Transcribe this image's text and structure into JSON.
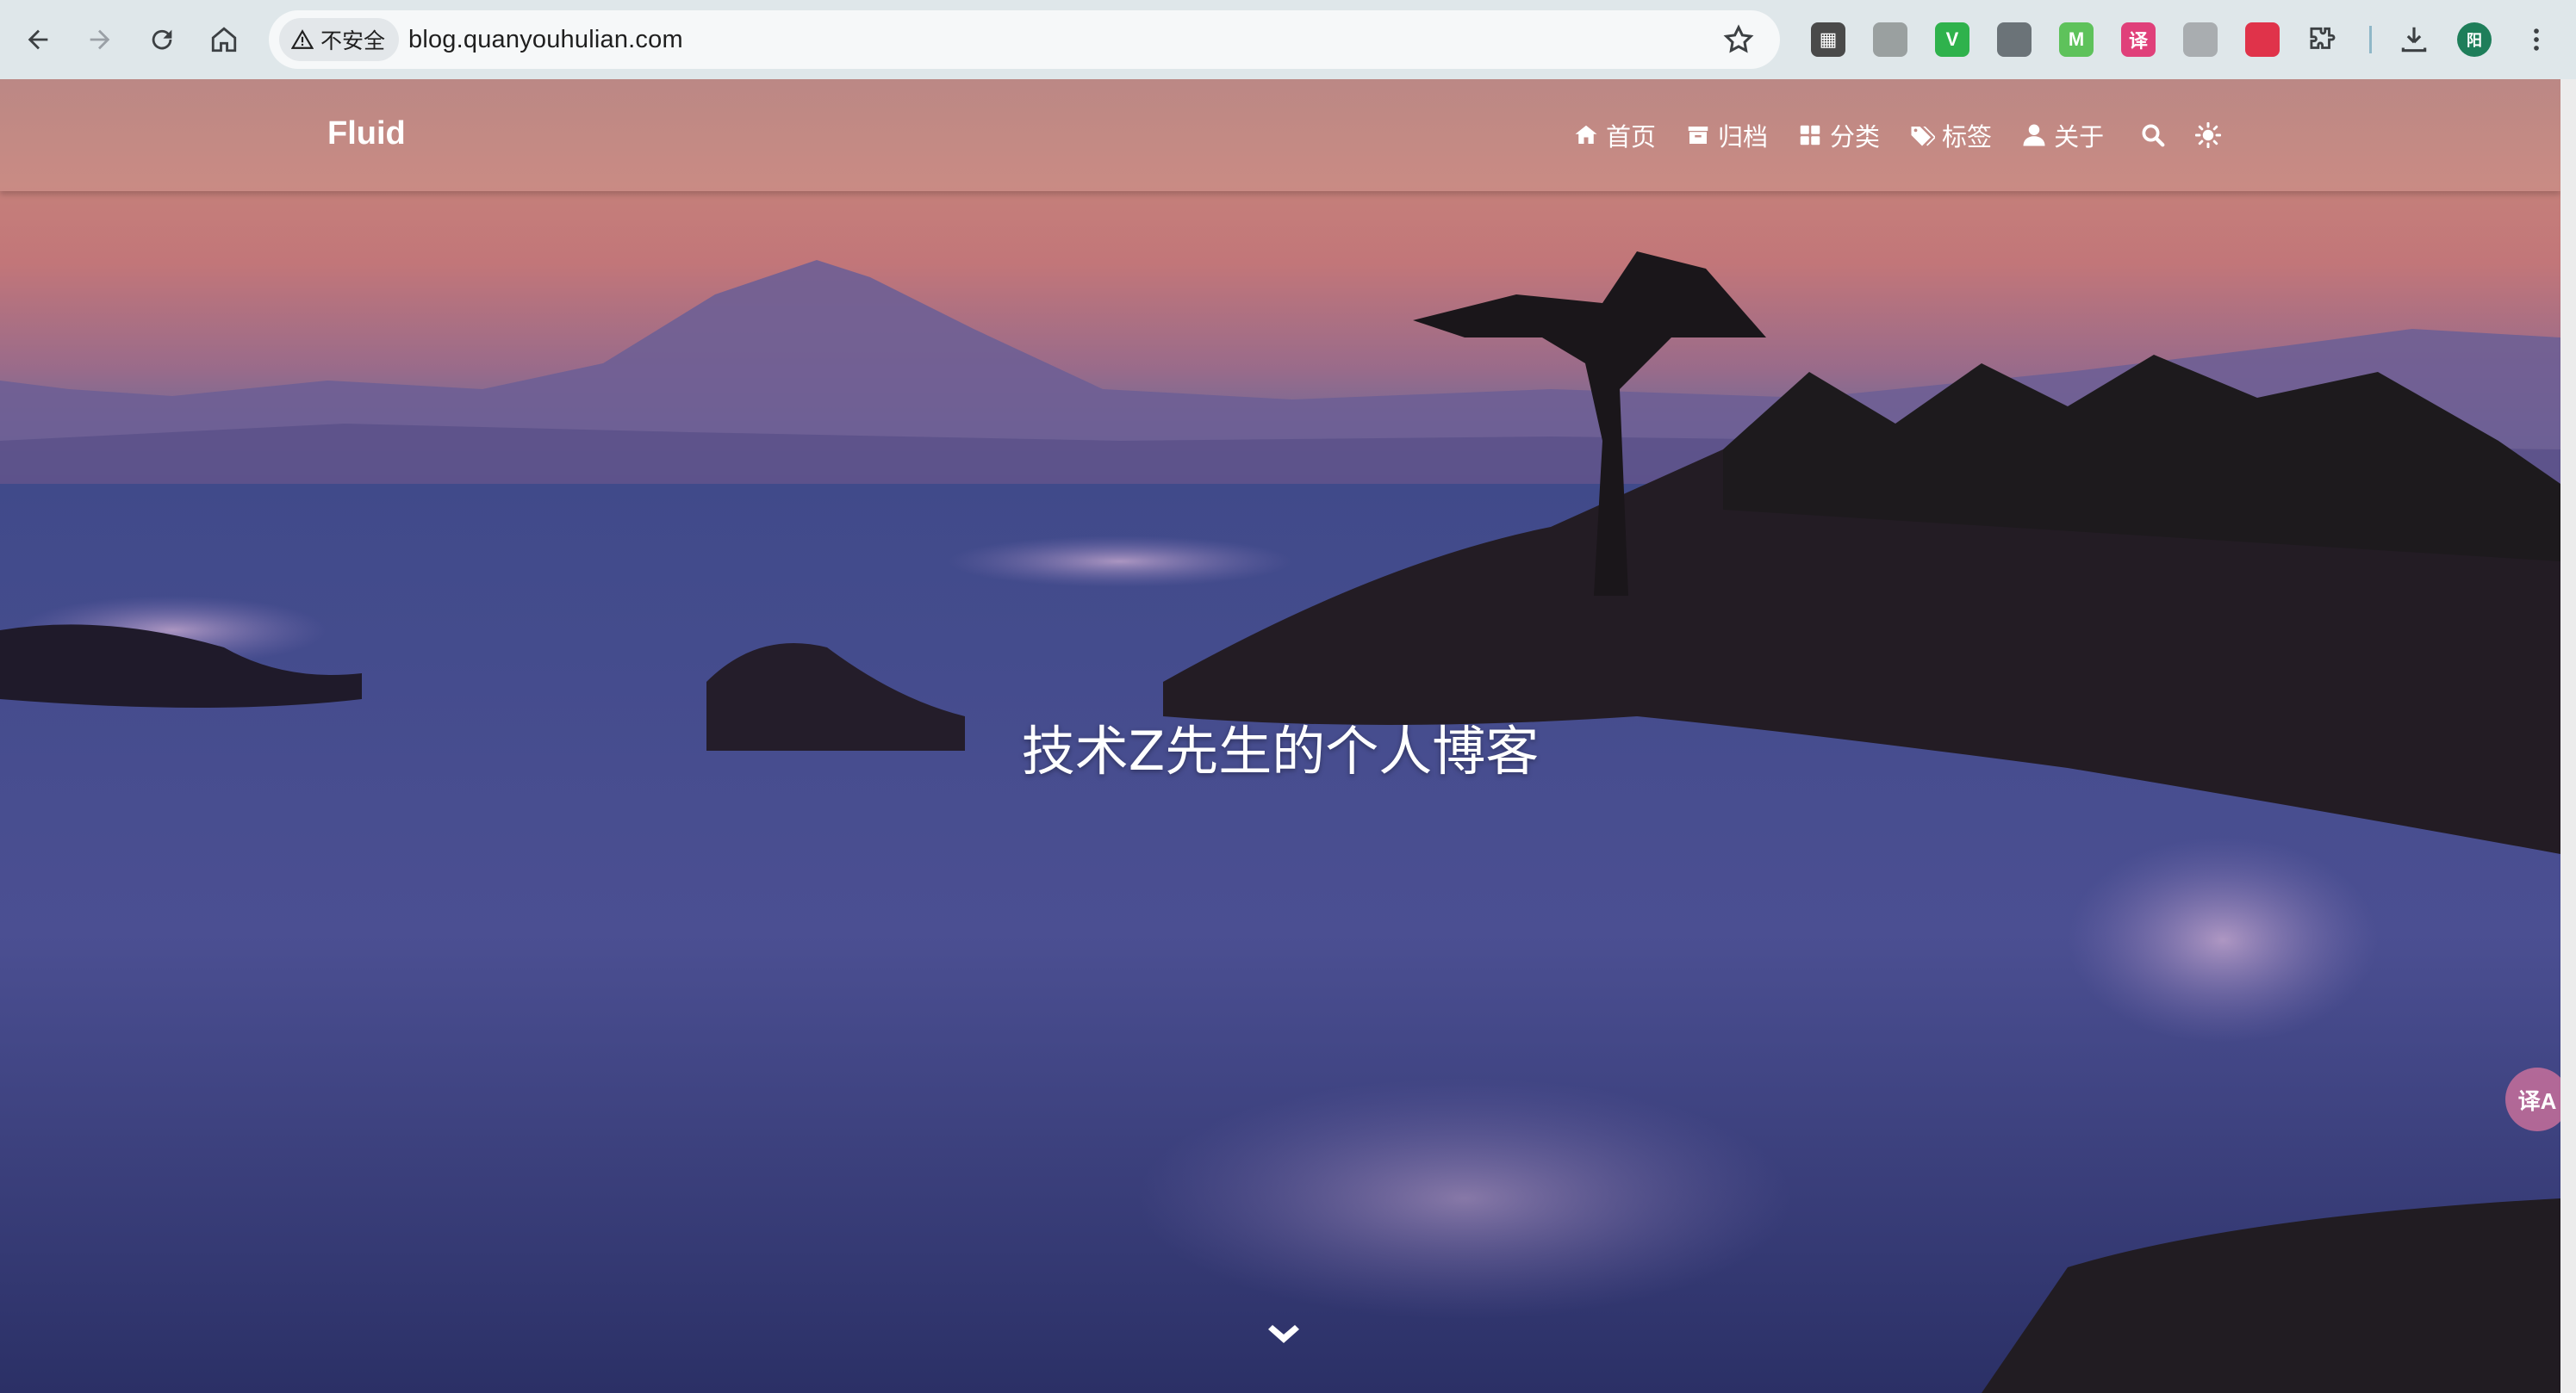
{
  "browser": {
    "security_label": "不安全",
    "url": "blog.quanyouhulian.com",
    "profile_initial": "阳",
    "extensions": [
      {
        "name": "qr-code-extension-icon",
        "glyph": "▦",
        "color": "#4a4a4a"
      },
      {
        "name": "gray-circle-extension-icon",
        "glyph": "",
        "color": "#9aa0a0"
      },
      {
        "name": "green-v-extension-icon",
        "glyph": "V",
        "color": "#2fb24c"
      },
      {
        "name": "gray-panel-extension-icon",
        "glyph": "",
        "color": "#6b7378"
      },
      {
        "name": "green-m-extension-icon",
        "glyph": "M",
        "color": "#5ec25b"
      },
      {
        "name": "translate-extension-icon",
        "glyph": "译",
        "color": "#e0407a"
      },
      {
        "name": "document-extension-icon",
        "glyph": "",
        "color": "#a9adb0"
      },
      {
        "name": "red-shield-extension-icon",
        "glyph": "",
        "color": "#e0334a"
      }
    ]
  },
  "site": {
    "brand": "Fluid",
    "menu": [
      {
        "label": "首页",
        "icon": "home-icon"
      },
      {
        "label": "归档",
        "icon": "archive-icon"
      },
      {
        "label": "分类",
        "icon": "grid-icon"
      },
      {
        "label": "标签",
        "icon": "tags-icon"
      },
      {
        "label": "关于",
        "icon": "user-icon"
      }
    ],
    "hero_title": "技术Z先生的个人博客",
    "translate_bubble": "译A"
  }
}
